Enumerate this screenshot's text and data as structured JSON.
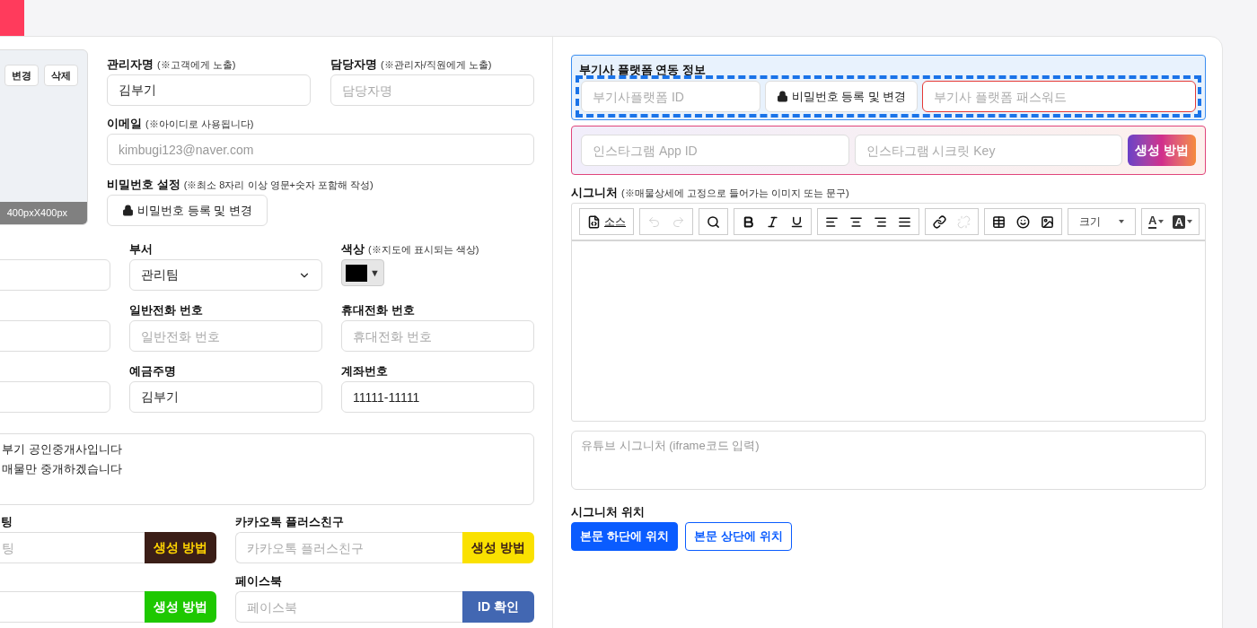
{
  "side_tab": {
    "color": "#ff3b5c"
  },
  "profile_photo": {
    "buttons": [
      "변경",
      "삭제"
    ],
    "caption": "400pxX400px"
  },
  "manager_name": {
    "label": "관리자명",
    "note": "(※고객에게 노출)",
    "value": "김부기"
  },
  "staff_name": {
    "label": "담당자명",
    "note": "(※관리자/직원에게 노출)",
    "placeholder": "담당자명"
  },
  "email": {
    "label": "이메일",
    "note": "(※아이디로 사용됩니다)",
    "value": "kimbugi123@naver.com",
    "disabled": true
  },
  "password": {
    "label": "비밀번호 설정",
    "note": "(※최소 8자리 이상 영문+숫자 포함해 작성)",
    "button": "비밀번호 등록 및 변경"
  },
  "rows": [
    [
      {
        "kind": "input"
      },
      {
        "kind": "select",
        "label": "부서",
        "value": "관리팀"
      },
      {
        "kind": "color",
        "label": "색상",
        "note": "(※지도에 표시되는 색상)",
        "color": "#000000",
        "caret": "▼"
      }
    ],
    [
      {
        "kind": "input"
      },
      {
        "kind": "input",
        "label": "일반전화 번호",
        "placeholder": "일반전화 번호"
      },
      {
        "kind": "input",
        "label": "휴대전화 번호",
        "placeholder": "휴대전화 번호"
      }
    ],
    [
      {
        "kind": "input"
      },
      {
        "kind": "input",
        "label": "예금주명",
        "value": "김부기"
      },
      {
        "kind": "input",
        "label": "계좌번호",
        "value": "11111-11111"
      }
    ]
  ],
  "intro": {
    "lines": [
      "부기 공인중개사입니다",
      "매물만 중개하겠습니다"
    ]
  },
  "social_columns": [
    [
      {
        "kind": "dark",
        "label": "팅",
        "placeholder": "팅",
        "button": "생성 방법"
      },
      {
        "kind": "green",
        "button": "생성 방법"
      }
    ],
    [
      {
        "kind": "yellow",
        "label": "카카오톡 플러스친구",
        "placeholder": "카카오톡 플러스친구",
        "button": "생성 방법"
      },
      {
        "kind": "blue",
        "label": "페이스북",
        "placeholder": "페이스북",
        "button": "ID 확인"
      }
    ]
  ],
  "platform": {
    "title": "부기사 플랫폼 연동 정보",
    "highlighted": true,
    "id_placeholder": "부기사플랫폼 ID",
    "button": "비밀번호 등록 및 변경",
    "password_placeholder": "부기사 플랫폼 패스워드",
    "password_invalid": true
  },
  "instagram": {
    "app_id_placeholder": "인스타그램 App ID",
    "secret_placeholder": "인스타그램 시크릿 Key",
    "button": "생성 방법"
  },
  "signature": {
    "label": "시그니처",
    "note": "(※매물상세에 고정으로 들어가는 이미지 또는 문구)",
    "toolbar": [
      [
        {
          "kind": "icon",
          "text": "소스",
          "disabled": false
        }
      ],
      [
        {
          "kind": "icon",
          "disabled": true
        },
        {
          "kind": "icon",
          "disabled": true
        }
      ],
      [
        {
          "kind": "icon",
          "disabled": false
        }
      ],
      [
        {
          "kind": "icon",
          "disabled": false
        },
        {
          "kind": "icon",
          "disabled": false
        },
        {
          "kind": "icon",
          "disabled": false
        }
      ],
      [
        {
          "kind": "icon",
          "disabled": false
        },
        {
          "kind": "icon",
          "disabled": false
        },
        {
          "kind": "icon",
          "disabled": false
        },
        {
          "kind": "icon",
          "disabled": false
        }
      ],
      [
        {
          "kind": "icon",
          "disabled": false
        },
        {
          "kind": "icon",
          "disabled": true
        }
      ],
      [
        {
          "kind": "icon",
          "disabled": false
        },
        {
          "kind": "icon",
          "disabled": false
        },
        {
          "kind": "icon",
          "disabled": false
        }
      ],
      [
        {
          "kind": "dropdown",
          "text": "크기"
        }
      ],
      [
        {
          "kind": "color",
          "text": "A",
          "filled": false
        },
        {
          "kind": "color",
          "text": "A",
          "filled": true
        }
      ]
    ]
  },
  "youtube": {
    "placeholder": "유튜브 시그니처 (iframe코드 입력)"
  },
  "position": {
    "label": "시그니처 위치",
    "options": [
      {
        "label": "본문 하단에 위치",
        "selected": true
      },
      {
        "label": "본문 상단에 위치",
        "selected": false
      }
    ]
  }
}
